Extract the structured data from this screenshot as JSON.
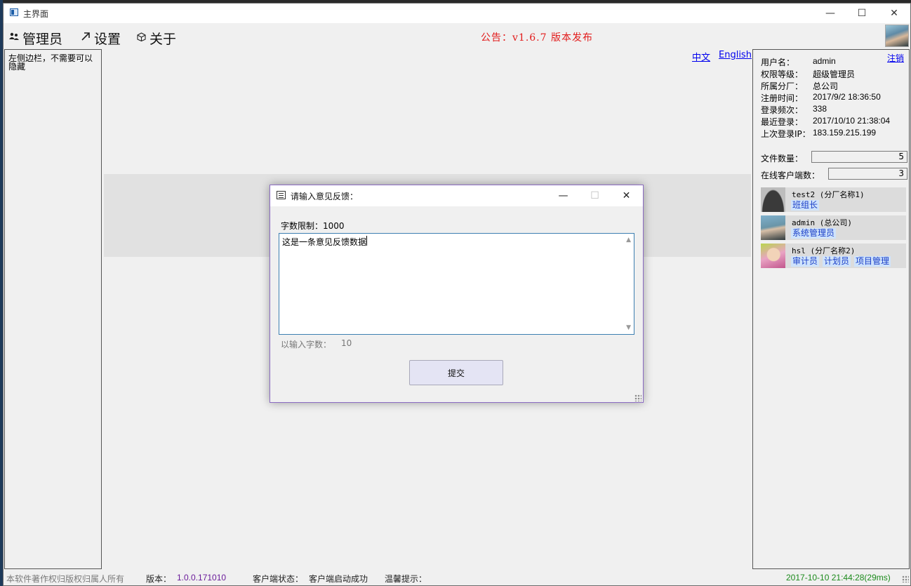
{
  "window": {
    "title": "主界面",
    "minimize_glyph": "—",
    "maximize_glyph": "☐",
    "close_glyph": "✕"
  },
  "menu": {
    "items": [
      {
        "label": "管理员",
        "icon": "users-icon"
      },
      {
        "label": "设置",
        "icon": "arrow-up-right-icon"
      },
      {
        "label": "关于",
        "icon": "cube-icon"
      }
    ]
  },
  "announcement": "公告：v1.6.7 版本发布",
  "sidebar": {
    "text": "左侧边栏，不需要可以隐藏"
  },
  "language": {
    "chinese": "中文",
    "english": "English"
  },
  "user_panel": {
    "logout_label": "注销",
    "fields": [
      {
        "label": "用户名：",
        "value": "admin"
      },
      {
        "label": "权限等级：",
        "value": "超级管理员"
      },
      {
        "label": "所属分厂：",
        "value": "总公司"
      },
      {
        "label": "注册时间：",
        "value": "2017/9/2 18:36:50"
      },
      {
        "label": "登录频次：",
        "value": "338"
      },
      {
        "label": "最近登录：",
        "value": "2017/10/10 21:38:04"
      },
      {
        "label": "上次登录IP：",
        "value": "183.159.215.199"
      }
    ],
    "file_count_label": "文件数量：",
    "file_count": "5",
    "online_clients_label": "在线客户端数：",
    "online_clients": "3",
    "clients": [
      {
        "name": "test2 (分厂名称1)",
        "roles": [
          "班组长"
        ],
        "avatar": "default-avatar-icon"
      },
      {
        "name": "admin (总公司)",
        "roles": [
          "系统管理员"
        ],
        "avatar": "photo-avatar"
      },
      {
        "name": "hsl (分厂名称2)",
        "roles": [
          "审计员",
          "计划员",
          "项目管理"
        ],
        "avatar": "photo-avatar"
      }
    ]
  },
  "status_bar": {
    "copyright": "本软件著作权归版权归属人所有",
    "version_label": "版本：",
    "version": "1.0.0.171010",
    "client_status_label": "客户端状态：",
    "client_status": "客户端启动成功",
    "tip_label": "温馨提示：",
    "time": "2017-10-10 21:44:28(29ms)"
  },
  "dialog": {
    "title": "请输入意见反馈：",
    "char_limit_label": "字数限制：1000",
    "feedback_text": "这是一条意见反馈数据",
    "input_count_label": "以输入字数：",
    "input_count": "10",
    "submit_label": "提交"
  }
}
